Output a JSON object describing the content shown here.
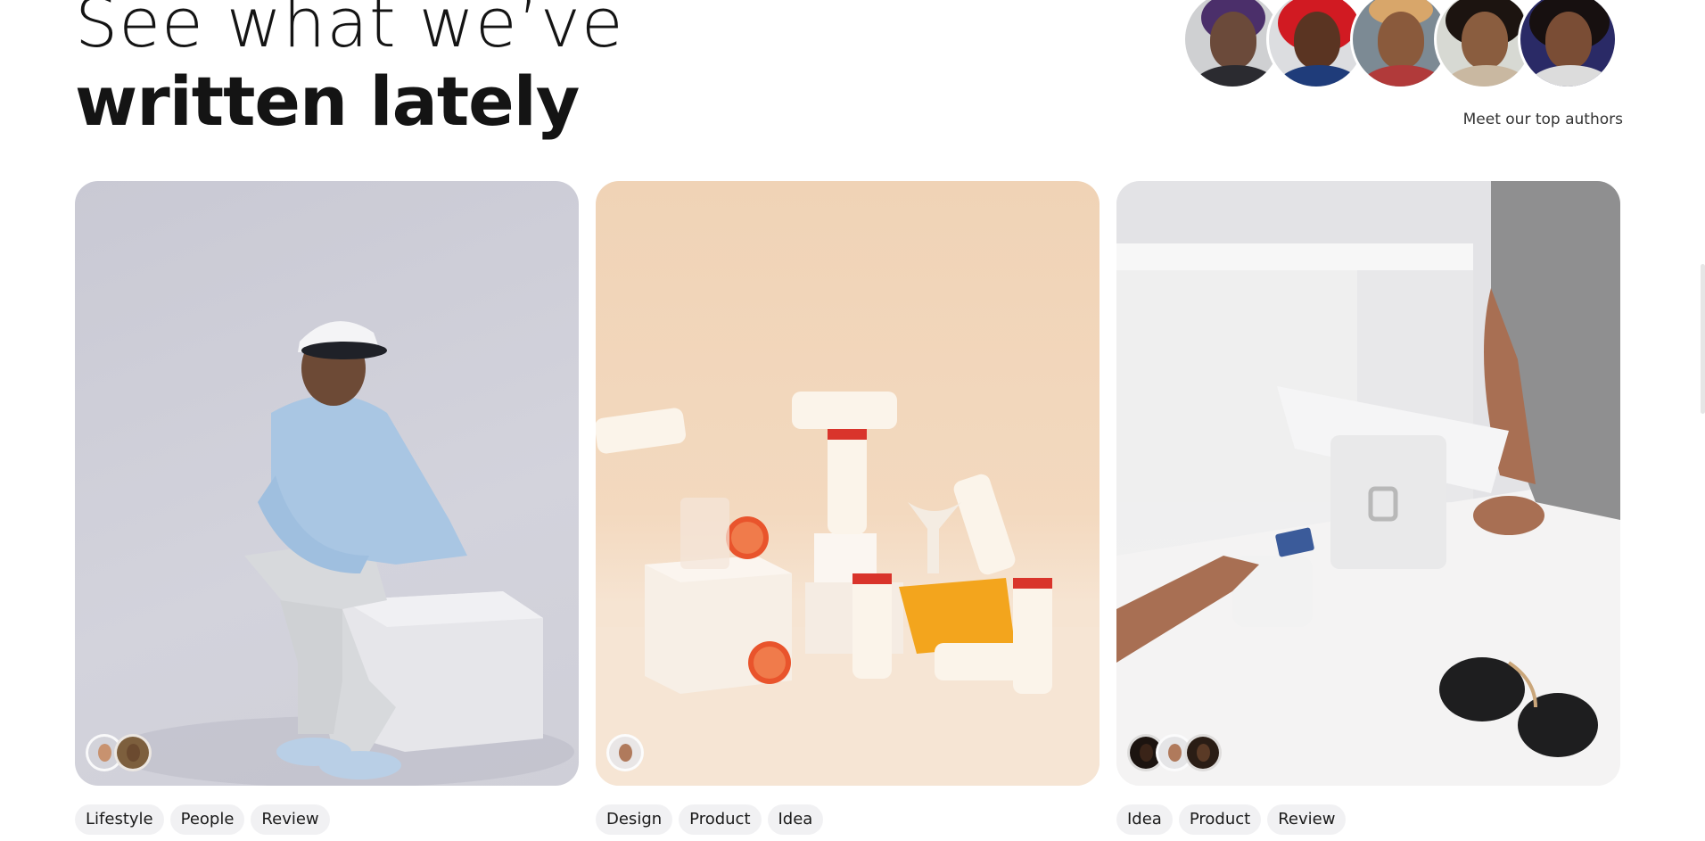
{
  "heading": {
    "line1": "See what we’ve",
    "line2": "written lately"
  },
  "authors": {
    "label": "Meet our top authors",
    "avatars": [
      {
        "name": "author-avatar-1",
        "bg": "#cfd0d2",
        "skin": "#6b4a3a",
        "hair": "#4b2f6a",
        "top": "#2b2b30"
      },
      {
        "name": "author-avatar-2",
        "bg": "#dcdde0",
        "skin": "#5a3422",
        "hair": "#d11a22",
        "top": "#1f3c7a"
      },
      {
        "name": "author-avatar-3",
        "bg": "#7c8a94",
        "skin": "#8a5a3c",
        "hair": "#d8a66a",
        "top": "#b13a3a"
      },
      {
        "name": "author-avatar-4",
        "bg": "#d7d9d3",
        "skin": "#8a5d3f",
        "hair": "#1c1410",
        "top": "#c9b8a1"
      },
      {
        "name": "author-avatar-5",
        "bg": "#2a2a66",
        "skin": "#7a4d35",
        "hair": "#171010",
        "top": "#dcdcdc"
      }
    ]
  },
  "cards": [
    {
      "name": "article-card-lifestyle",
      "tags": [
        "Lifestyle",
        "People",
        "Review"
      ],
      "authors": [
        {
          "face": "#c8926f"
        },
        {
          "face": "#6b4a2f"
        }
      ]
    },
    {
      "name": "article-card-design",
      "tags": [
        "Design",
        "Product",
        "Idea"
      ],
      "authors": [
        {
          "face": "#b07a5c"
        }
      ]
    },
    {
      "name": "article-card-idea",
      "tags": [
        "Idea",
        "Product",
        "Review"
      ],
      "authors": [
        {
          "face": "#3a2418"
        },
        {
          "face": "#b07a5c"
        },
        {
          "face": "#5a3a26"
        }
      ]
    }
  ]
}
